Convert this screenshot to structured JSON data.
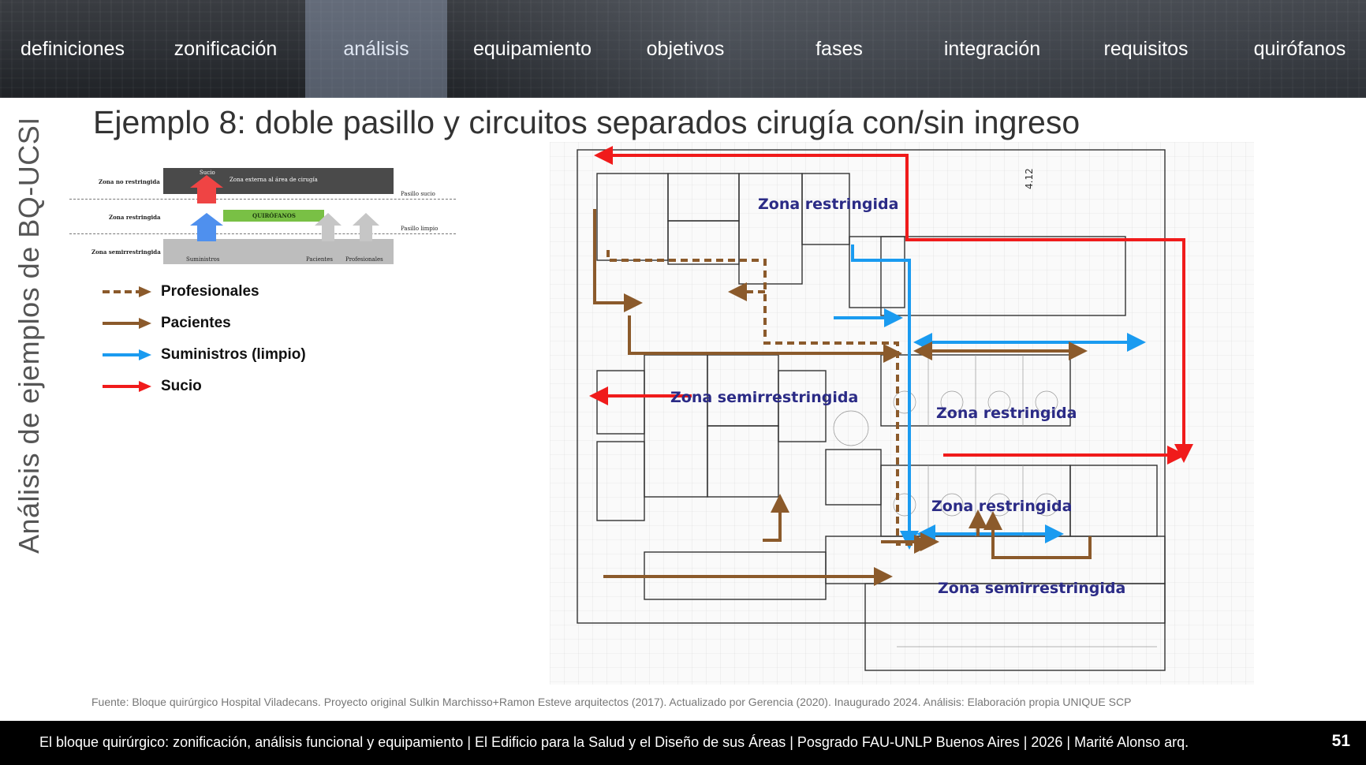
{
  "nav": {
    "items": [
      {
        "label": "definiciones"
      },
      {
        "label": "zonificación"
      },
      {
        "label": "análisis"
      },
      {
        "label": "equipamiento"
      },
      {
        "label": "objetivos"
      },
      {
        "label": "fases"
      },
      {
        "label": "integración"
      },
      {
        "label": "requisitos"
      },
      {
        "label": "quirófanos"
      }
    ],
    "active_label": "análisis"
  },
  "side_title": "Análisis de ejemplos de BQ-UCSI",
  "title": "Ejemplo 8: doble pasillo y circuitos separados cirugía con/sin ingreso",
  "zone_diagram": {
    "rows": [
      "Zona no restringida",
      "Zona restringida",
      "Zona semirrestringida"
    ],
    "corridors": [
      "Pasillo sucio",
      "Pasillo limpio"
    ],
    "sucio_label": "Sucio",
    "outer_label": "Zona externa al área de cirugía",
    "quirofanos_label": "QUIRÓFANOS",
    "suministros_label": "Suministros",
    "pacientes_label": "Pacientes",
    "profesionales_label": "Profesionales",
    "colors": {
      "sucio": "#ef3e3e",
      "limpio": "#4a8ff0",
      "green": "#79c045",
      "grey_arrow": "#c9c9c9"
    }
  },
  "legend": [
    {
      "label": "Profesionales",
      "style": "dashed",
      "color": "#8b5a2b"
    },
    {
      "label": "Pacientes",
      "style": "solid",
      "color": "#8b5a2b"
    },
    {
      "label": "Suministros (limpio)",
      "style": "solid",
      "color": "#1a9bf0"
    },
    {
      "label": "Sucio",
      "style": "solid",
      "color": "#f01b1b"
    }
  ],
  "plan": {
    "zones": [
      "Zona restringida",
      "Zona semirrestringida",
      "Zona restringida",
      "Zona restringida",
      "Zona semirrestringida"
    ],
    "dimension_label": "4.12"
  },
  "source": "Fuente: Bloque quirúrgico Hospital Viladecans. Proyecto original Sulkin Marchisso+Ramon Esteve arquitectos (2017). Actualizado por Gerencia (2020). Inaugurado 2024. Análisis: Elaboración propia UNIQUE SCP",
  "footer": {
    "text": "El bloque quirúrgico: zonificación, análisis funcional y equipamiento  |  El Edificio para la Salud y el Diseño de sus Áreas  |  Posgrado FAU-UNLP Buenos Aires  |  2026  |  Marité Alonso arq.",
    "page_number": "51"
  }
}
